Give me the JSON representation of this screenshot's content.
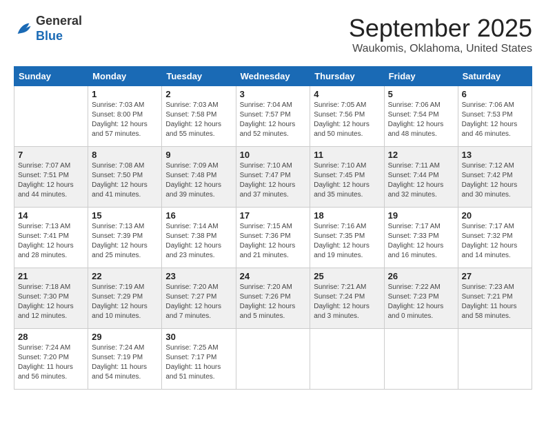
{
  "header": {
    "logo_line1": "General",
    "logo_line2": "Blue",
    "month": "September 2025",
    "location": "Waukomis, Oklahoma, United States"
  },
  "weekdays": [
    "Sunday",
    "Monday",
    "Tuesday",
    "Wednesday",
    "Thursday",
    "Friday",
    "Saturday"
  ],
  "weeks": [
    [
      {
        "day": "",
        "info": ""
      },
      {
        "day": "1",
        "info": "Sunrise: 7:03 AM\nSunset: 8:00 PM\nDaylight: 12 hours\nand 57 minutes."
      },
      {
        "day": "2",
        "info": "Sunrise: 7:03 AM\nSunset: 7:58 PM\nDaylight: 12 hours\nand 55 minutes."
      },
      {
        "day": "3",
        "info": "Sunrise: 7:04 AM\nSunset: 7:57 PM\nDaylight: 12 hours\nand 52 minutes."
      },
      {
        "day": "4",
        "info": "Sunrise: 7:05 AM\nSunset: 7:56 PM\nDaylight: 12 hours\nand 50 minutes."
      },
      {
        "day": "5",
        "info": "Sunrise: 7:06 AM\nSunset: 7:54 PM\nDaylight: 12 hours\nand 48 minutes."
      },
      {
        "day": "6",
        "info": "Sunrise: 7:06 AM\nSunset: 7:53 PM\nDaylight: 12 hours\nand 46 minutes."
      }
    ],
    [
      {
        "day": "7",
        "info": "Sunrise: 7:07 AM\nSunset: 7:51 PM\nDaylight: 12 hours\nand 44 minutes."
      },
      {
        "day": "8",
        "info": "Sunrise: 7:08 AM\nSunset: 7:50 PM\nDaylight: 12 hours\nand 41 minutes."
      },
      {
        "day": "9",
        "info": "Sunrise: 7:09 AM\nSunset: 7:48 PM\nDaylight: 12 hours\nand 39 minutes."
      },
      {
        "day": "10",
        "info": "Sunrise: 7:10 AM\nSunset: 7:47 PM\nDaylight: 12 hours\nand 37 minutes."
      },
      {
        "day": "11",
        "info": "Sunrise: 7:10 AM\nSunset: 7:45 PM\nDaylight: 12 hours\nand 35 minutes."
      },
      {
        "day": "12",
        "info": "Sunrise: 7:11 AM\nSunset: 7:44 PM\nDaylight: 12 hours\nand 32 minutes."
      },
      {
        "day": "13",
        "info": "Sunrise: 7:12 AM\nSunset: 7:42 PM\nDaylight: 12 hours\nand 30 minutes."
      }
    ],
    [
      {
        "day": "14",
        "info": "Sunrise: 7:13 AM\nSunset: 7:41 PM\nDaylight: 12 hours\nand 28 minutes."
      },
      {
        "day": "15",
        "info": "Sunrise: 7:13 AM\nSunset: 7:39 PM\nDaylight: 12 hours\nand 25 minutes."
      },
      {
        "day": "16",
        "info": "Sunrise: 7:14 AM\nSunset: 7:38 PM\nDaylight: 12 hours\nand 23 minutes."
      },
      {
        "day": "17",
        "info": "Sunrise: 7:15 AM\nSunset: 7:36 PM\nDaylight: 12 hours\nand 21 minutes."
      },
      {
        "day": "18",
        "info": "Sunrise: 7:16 AM\nSunset: 7:35 PM\nDaylight: 12 hours\nand 19 minutes."
      },
      {
        "day": "19",
        "info": "Sunrise: 7:17 AM\nSunset: 7:33 PM\nDaylight: 12 hours\nand 16 minutes."
      },
      {
        "day": "20",
        "info": "Sunrise: 7:17 AM\nSunset: 7:32 PM\nDaylight: 12 hours\nand 14 minutes."
      }
    ],
    [
      {
        "day": "21",
        "info": "Sunrise: 7:18 AM\nSunset: 7:30 PM\nDaylight: 12 hours\nand 12 minutes."
      },
      {
        "day": "22",
        "info": "Sunrise: 7:19 AM\nSunset: 7:29 PM\nDaylight: 12 hours\nand 10 minutes."
      },
      {
        "day": "23",
        "info": "Sunrise: 7:20 AM\nSunset: 7:27 PM\nDaylight: 12 hours\nand 7 minutes."
      },
      {
        "day": "24",
        "info": "Sunrise: 7:20 AM\nSunset: 7:26 PM\nDaylight: 12 hours\nand 5 minutes."
      },
      {
        "day": "25",
        "info": "Sunrise: 7:21 AM\nSunset: 7:24 PM\nDaylight: 12 hours\nand 3 minutes."
      },
      {
        "day": "26",
        "info": "Sunrise: 7:22 AM\nSunset: 7:23 PM\nDaylight: 12 hours\nand 0 minutes."
      },
      {
        "day": "27",
        "info": "Sunrise: 7:23 AM\nSunset: 7:21 PM\nDaylight: 11 hours\nand 58 minutes."
      }
    ],
    [
      {
        "day": "28",
        "info": "Sunrise: 7:24 AM\nSunset: 7:20 PM\nDaylight: 11 hours\nand 56 minutes."
      },
      {
        "day": "29",
        "info": "Sunrise: 7:24 AM\nSunset: 7:19 PM\nDaylight: 11 hours\nand 54 minutes."
      },
      {
        "day": "30",
        "info": "Sunrise: 7:25 AM\nSunset: 7:17 PM\nDaylight: 11 hours\nand 51 minutes."
      },
      {
        "day": "",
        "info": ""
      },
      {
        "day": "",
        "info": ""
      },
      {
        "day": "",
        "info": ""
      },
      {
        "day": "",
        "info": ""
      }
    ]
  ],
  "row_shading": [
    false,
    true,
    false,
    true,
    false
  ]
}
